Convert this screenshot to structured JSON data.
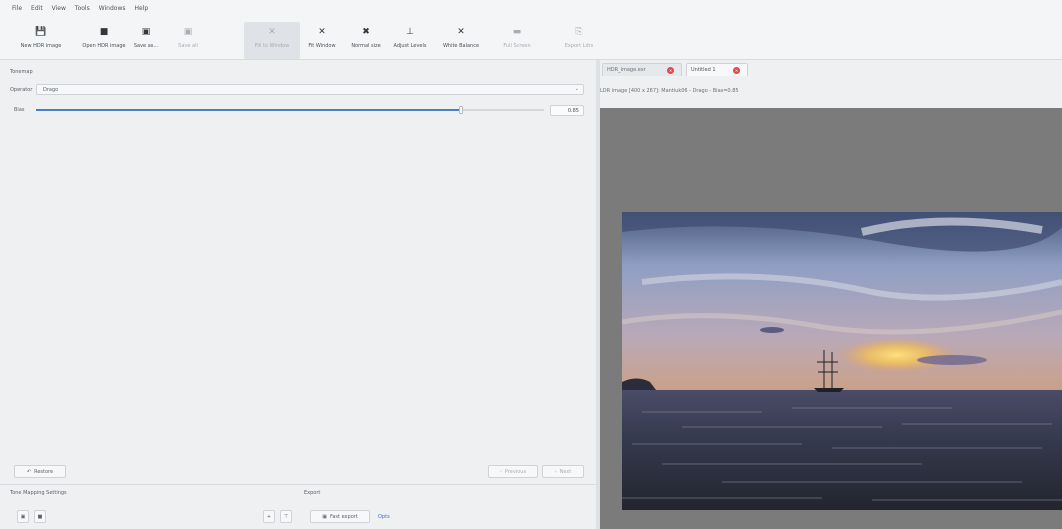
{
  "menu": [
    "File",
    "Edit",
    "View",
    "Tools",
    "Windows",
    "Help"
  ],
  "toolbar": [
    {
      "icon": "save-icon",
      "glyph": "💾",
      "label": "New HDR image",
      "disabled": false
    },
    {
      "icon": "folder-icon",
      "glyph": "■",
      "label": "Open HDR image",
      "disabled": false
    },
    {
      "icon": "save-icon",
      "glyph": "▣",
      "label": "Save as...",
      "disabled": false
    },
    {
      "icon": "save-icon",
      "glyph": "▣",
      "label": "Save all",
      "disabled": true
    },
    {
      "icon": "fill-window-icon",
      "glyph": "✕",
      "label": "Fill to Window",
      "disabled": true
    },
    {
      "icon": "fit-window-icon",
      "glyph": "✕",
      "label": "Fit Window",
      "disabled": false
    },
    {
      "icon": "normal-size-icon",
      "glyph": "✖",
      "label": "Normal size",
      "disabled": false
    },
    {
      "icon": "levels-icon",
      "glyph": "⊥",
      "label": "Adjust Levels",
      "disabled": false
    },
    {
      "icon": "white-balance-icon",
      "glyph": "✕",
      "label": "White Balance",
      "disabled": false
    },
    {
      "icon": "full-screen-icon",
      "glyph": "▬",
      "label": "Full Screen",
      "disabled": true
    },
    {
      "icon": "export-icon",
      "glyph": "⎘",
      "label": "Export Ldrs",
      "disabled": true
    }
  ],
  "tonemap": {
    "title": "Tonemap",
    "operator_label": "Operator",
    "operator_value": "Drago",
    "param_label": "Bias",
    "param_value": "0.85",
    "param_fraction": 0.85
  },
  "nav": {
    "restore": "Restore",
    "previous": "Previous",
    "next": "Next"
  },
  "sections": {
    "settings_title": "Tone Mapping Settings",
    "export_title": "Export",
    "fast_export": "Fast export",
    "options": "Opts"
  },
  "tabs": [
    {
      "label": "HDR_image.exr"
    },
    {
      "label": "Untitled 1"
    }
  ],
  "image_info": "LDR image [400 x 267]: Mantiuk06 - Drago - Bias=0.85",
  "colors": {
    "accent": "#4a7fc4",
    "close": "#e2474e",
    "viewer_bg": "#7b7b7b"
  }
}
